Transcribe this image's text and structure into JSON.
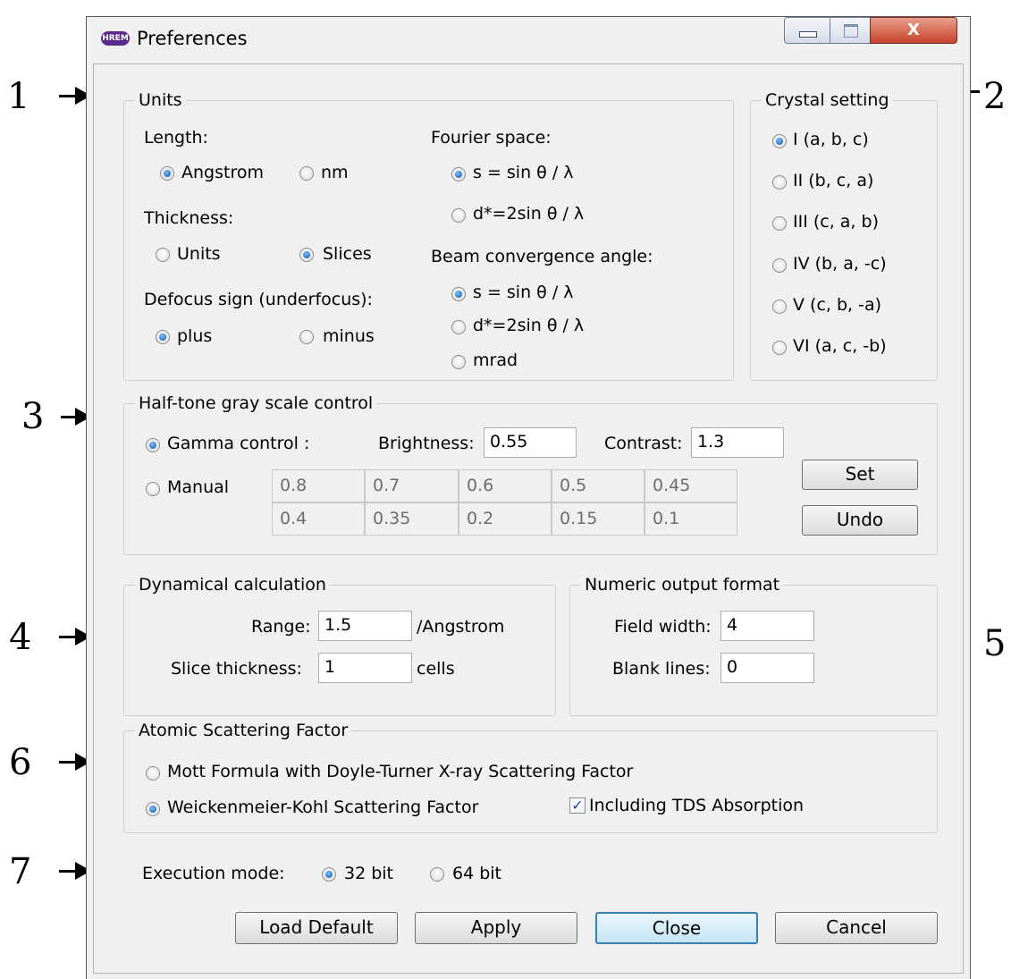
{
  "callouts": [
    "1",
    "2",
    "3",
    "4",
    "5",
    "6",
    "7"
  ],
  "window": {
    "title": "Preferences",
    "app_icon_text": "HREM",
    "close_glyph": "X"
  },
  "units": {
    "title": "Units",
    "length": {
      "label": "Length:",
      "options": [
        "Angstrom",
        "nm"
      ],
      "selected": "Angstrom"
    },
    "thickness": {
      "label": "Thickness:",
      "options": [
        "Units",
        "Slices"
      ],
      "selected": "Slices"
    },
    "defocus": {
      "label": "Defocus sign (underfocus):",
      "options": [
        "plus",
        "minus"
      ],
      "selected": "plus"
    },
    "fourier": {
      "label": "Fourier space:",
      "options": [
        "s = sin θ / λ",
        "d*=2sin θ / λ"
      ],
      "selected": "s = sin θ / λ"
    },
    "beam": {
      "label": "Beam convergence angle:",
      "options": [
        "s = sin θ / λ",
        "d*=2sin θ / λ",
        "mrad"
      ],
      "selected": "s = sin θ / λ"
    }
  },
  "crystal": {
    "title": "Crystal setting",
    "options": [
      "I (a, b, c)",
      "II (b, c, a)",
      "III (c, a, b)",
      "IV (b, a, -c)",
      "V (c, b, -a)",
      "VI (a, c, -b)"
    ],
    "selected": "I (a, b, c)"
  },
  "halftone": {
    "title": "Half-tone gray scale control",
    "gamma_label": "Gamma control :",
    "manual_label": "Manual",
    "selected": "Gamma control",
    "brightness_label": "Brightness:",
    "brightness_value": "0.55",
    "contrast_label": "Contrast:",
    "contrast_value": "1.3",
    "manual_values": [
      [
        "0.8",
        "0.7",
        "0.6",
        "0.5",
        "0.45"
      ],
      [
        "0.4",
        "0.35",
        "0.2",
        "0.15",
        "0.1"
      ]
    ],
    "set_label": "Set",
    "undo_label": "Undo"
  },
  "dynamical": {
    "title": "Dynamical calculation",
    "range_label": "Range:",
    "range_value": "1.5",
    "range_unit": "/Angstrom",
    "slice_label": "Slice thickness:",
    "slice_value": "1",
    "slice_unit": "cells"
  },
  "numeric": {
    "title": "Numeric output format",
    "field_width_label": "Field width:",
    "field_width_value": "4",
    "blank_lines_label": "Blank lines:",
    "blank_lines_value": "0"
  },
  "scattering": {
    "title": "Atomic Scattering Factor",
    "options": [
      "Mott Formula with Doyle-Turner X-ray Scattering Factor",
      "Weickenmeier-Kohl Scattering Factor"
    ],
    "selected": "Weickenmeier-Kohl Scattering Factor",
    "tds_label": "Including TDS Absorption",
    "tds_checked": true
  },
  "execution": {
    "label": "Execution mode:",
    "options": [
      "32 bit",
      "64 bit"
    ],
    "selected": "32 bit"
  },
  "buttons": {
    "load_default": "Load Default",
    "apply": "Apply",
    "close": "Close",
    "cancel": "Cancel"
  }
}
